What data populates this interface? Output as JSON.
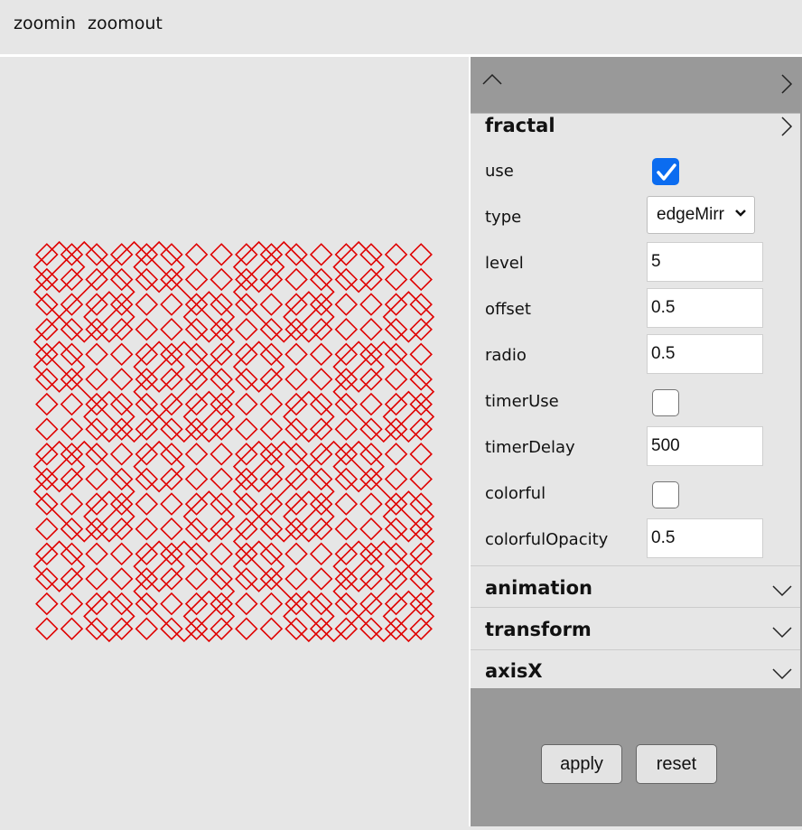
{
  "toolbar": {
    "zoomin": "zoomin",
    "zoomout": "zoomout"
  },
  "canvas": {
    "stroke_color": "#e00000",
    "curve_type": "fractal-square-curve"
  },
  "panel": {
    "header_icons": {
      "left": "chevron-up-icon",
      "right": "chevron-right-icon"
    },
    "sections": {
      "fractal": {
        "title": "fractal",
        "icon": "chevron-right-icon",
        "fields": {
          "use": {
            "label": "use",
            "checked": true
          },
          "type": {
            "label": "type",
            "value": "edgeMirr"
          },
          "level": {
            "label": "level",
            "value": "5"
          },
          "offset": {
            "label": "offset",
            "value": "0.5"
          },
          "radio": {
            "label": "radio",
            "value": "0.5"
          },
          "timerUse": {
            "label": "timerUse",
            "checked": false
          },
          "timerDelay": {
            "label": "timerDelay",
            "value": "500"
          },
          "colorful": {
            "label": "colorful",
            "checked": false
          },
          "colorfulOpacity": {
            "label": "colorfulOpacity",
            "value": "0.5"
          }
        }
      },
      "animation": {
        "title": "animation",
        "icon": "chevron-down-icon"
      },
      "transform": {
        "title": "transform",
        "icon": "chevron-down-icon"
      },
      "axisX": {
        "title": "axisX",
        "icon": "chevron-down-icon"
      }
    },
    "buttons": {
      "apply": "apply",
      "reset": "reset"
    }
  },
  "colors": {
    "checkbox_on": "#0b6cf0",
    "panel_gray": "#999999",
    "background": "#e6e6e6"
  }
}
